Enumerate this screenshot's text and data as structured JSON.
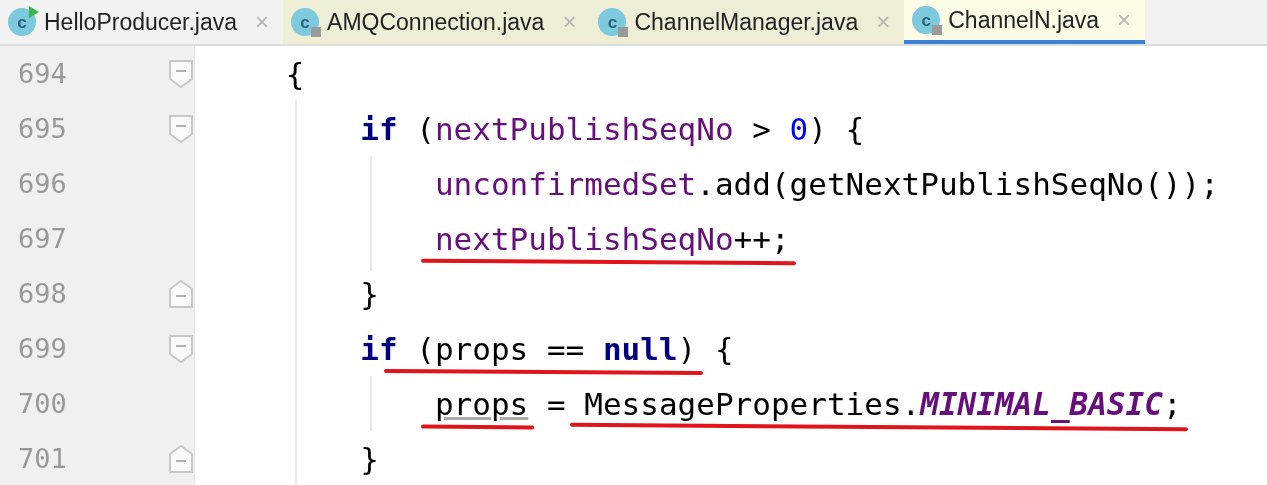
{
  "tabs": [
    {
      "label": "HelloProducer.java",
      "icon_letter": "c",
      "run_config": true,
      "locked": false,
      "in_project": false,
      "close": "×",
      "selected": false
    },
    {
      "label": "AMQConnection.java",
      "icon_letter": "c",
      "run_config": false,
      "locked": true,
      "in_project": true,
      "close": "×",
      "selected": false
    },
    {
      "label": "ChannelManager.java",
      "icon_letter": "c",
      "run_config": false,
      "locked": true,
      "in_project": true,
      "close": "×",
      "selected": false
    },
    {
      "label": "ChannelN.java",
      "icon_letter": "c",
      "run_config": false,
      "locked": true,
      "in_project": true,
      "close": "×",
      "selected": true
    }
  ],
  "editor": {
    "lines": [
      {
        "number": "694",
        "fold_start": true,
        "fold_end": false,
        "tokens": [
          {
            "kind": "plain",
            "text": "{",
            "marked": false
          }
        ],
        "children": [
          {
            "number": "695",
            "fold_start": true,
            "fold_end": false,
            "tokens": [
              {
                "kind": "keyword",
                "text": "if",
                "marked": false
              },
              {
                "kind": "plain",
                "text": " (",
                "marked": false
              },
              {
                "kind": "field",
                "text": "nextPublishSeqNo",
                "marked": false
              },
              {
                "kind": "plain",
                "text": " > ",
                "marked": false
              },
              {
                "kind": "number",
                "text": "0",
                "marked": false
              },
              {
                "kind": "plain",
                "text": ") {",
                "marked": false
              }
            ],
            "children": [
              {
                "number": "696",
                "fold_start": false,
                "fold_end": false,
                "tokens": [
                  {
                    "kind": "field",
                    "text": "unconfirmedSet",
                    "marked": false
                  },
                  {
                    "kind": "plain",
                    "text": ".add(getNextPublishSeqNo());",
                    "marked": false
                  }
                ]
              },
              {
                "number": "697",
                "fold_start": false,
                "fold_end": false,
                "tokens": [
                  {
                    "kind": "field",
                    "text": "nextPublishSeqNo",
                    "marked": true
                  },
                  {
                    "kind": "plain",
                    "text": "++;",
                    "marked": true
                  }
                ]
              }
            ]
          },
          {
            "number": "698",
            "fold_start": false,
            "fold_end": true,
            "tokens": [
              {
                "kind": "plain",
                "text": "}",
                "marked": false
              }
            ]
          },
          {
            "number": "699",
            "fold_start": true,
            "fold_end": false,
            "tokens": [
              {
                "kind": "keyword",
                "text": "if",
                "marked": false
              },
              {
                "kind": "plain",
                "text": " (props == ",
                "marked": true
              },
              {
                "kind": "keyword",
                "text": "null",
                "marked": true
              },
              {
                "kind": "plain",
                "text": ")",
                "marked": true
              },
              {
                "kind": "plain",
                "text": " {",
                "marked": false
              }
            ],
            "children": [
              {
                "number": "700",
                "fold_start": false,
                "fold_end": false,
                "tokens": [
                  {
                    "kind": "reassigned",
                    "text": "props",
                    "marked": true
                  },
                  {
                    "kind": "plain",
                    "text": " = ",
                    "marked": false
                  },
                  {
                    "kind": "plain",
                    "text": "MessageProperties.",
                    "marked": true
                  },
                  {
                    "kind": "static",
                    "text": "MINIMAL_BASIC",
                    "marked": true
                  },
                  {
                    "kind": "plain",
                    "text": ";",
                    "marked": true
                  }
                ]
              }
            ]
          },
          {
            "number": "701",
            "fold_start": false,
            "fold_end": true,
            "tokens": [
              {
                "kind": "plain",
                "text": "}",
                "marked": false
              }
            ]
          }
        ]
      }
    ]
  }
}
